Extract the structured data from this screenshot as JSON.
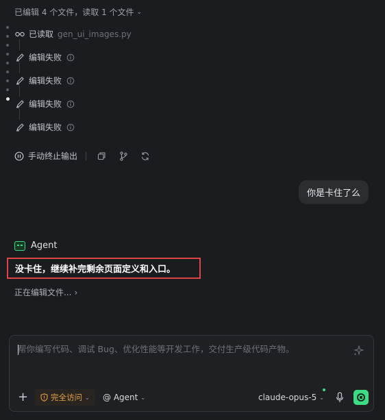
{
  "summary": {
    "text": "已编辑 4 个文件，读取 1 个文件",
    "chevron": "⌄"
  },
  "activity": [
    {
      "icon": "glasses-icon",
      "label": "已读取",
      "file": "gen_ui_images.py"
    },
    {
      "icon": "pen-icon",
      "label": "编辑失败",
      "info_icon": "info-icon"
    },
    {
      "icon": "pen-icon",
      "label": "编辑失败",
      "info_icon": "info-icon"
    },
    {
      "icon": "pen-icon",
      "label": "编辑失败",
      "info_icon": "info-icon"
    },
    {
      "icon": "pen-icon",
      "label": "编辑失败",
      "info_icon": "info-icon"
    }
  ],
  "stop": {
    "label": "手动终止输出",
    "icon": "pause-circle-icon",
    "tools": [
      "copy-icon",
      "branch-icon",
      "refresh-icon"
    ]
  },
  "user_message": "你是卡住了么",
  "agent": {
    "name": "Agent",
    "reply": "没卡住，继续补完剩余页面定义和入口。",
    "editing": "正在编辑文件...",
    "editing_chevron": "›"
  },
  "composer": {
    "placeholder": "帮你编写代码、调试 Bug、优化性能等开发工作，交付生产级代码产物。",
    "plus": "+",
    "access_label": "完全访问",
    "agent_mode": "@ Agent",
    "model": "claude-opus-5"
  },
  "colors": {
    "accent": "#3ddc84",
    "warning": "#e5a146",
    "highlight_border": "#e04545"
  }
}
